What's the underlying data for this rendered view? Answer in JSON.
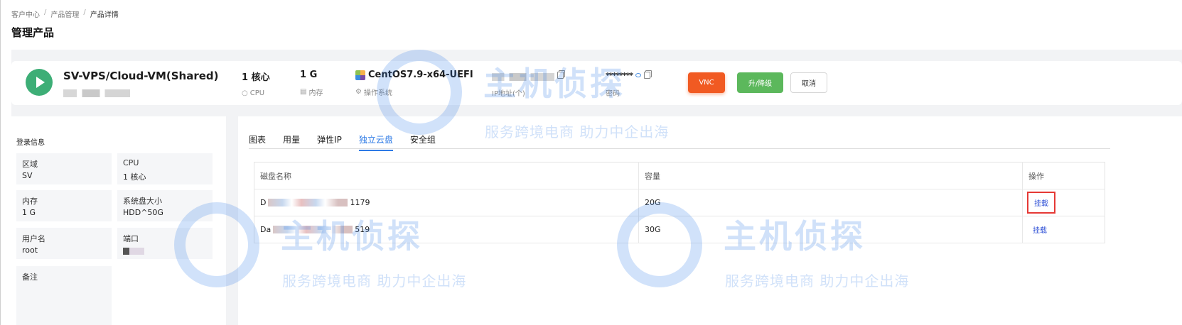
{
  "breadcrumb": {
    "items": [
      "客户中心",
      "产品管理",
      "产品详情"
    ]
  },
  "page_title": "管理产品",
  "product": {
    "name": "SV-VPS/Cloud-VM(Shared)",
    "cpu_value": "1 核心",
    "cpu_label": "CPU",
    "mem_value": "1 G",
    "mem_label": "内存",
    "os_value": "CentOS7.9-x64-UEFI",
    "os_label": "操作系统",
    "ip_label": "IP地址(个)",
    "password_value": "********",
    "password_label": "密码"
  },
  "buttons": {
    "vnc": "VNC",
    "upgrade": "升/降级",
    "cancel": "取消"
  },
  "login_info": {
    "title": "登录信息",
    "cells": [
      {
        "key": "区域",
        "value": "SV"
      },
      {
        "key": "CPU",
        "value": "1 核心"
      },
      {
        "key": "内存",
        "value": "1 G"
      },
      {
        "key": "系统盘大小",
        "value": "HDD^50G"
      },
      {
        "key": "用户名",
        "value": "root"
      },
      {
        "key": "端口",
        "value": ""
      },
      {
        "key": "备注",
        "value": ""
      }
    ]
  },
  "tabs": [
    "图表",
    "用量",
    "弹性IP",
    "独立云盘",
    "安全组"
  ],
  "active_tab": "独立云盘",
  "disk_table": {
    "headers": [
      "磁盘名称",
      "容量",
      "操作"
    ],
    "rows": [
      {
        "name_prefix": "D",
        "name_suffix": "1179",
        "capacity": "20G",
        "action": "挂载"
      },
      {
        "name_prefix": "Da",
        "name_suffix": "519",
        "capacity": "30G",
        "action": "挂载"
      }
    ]
  },
  "watermark": {
    "brand": "主机侦探",
    "slogan": "服务跨境电商 助力中企出海"
  },
  "colors": {
    "accent": "#2d7ae6",
    "vnc": "#f15a22",
    "upgrade": "#5cb85c",
    "running": "#3dae76",
    "highlight": "#e53935"
  }
}
